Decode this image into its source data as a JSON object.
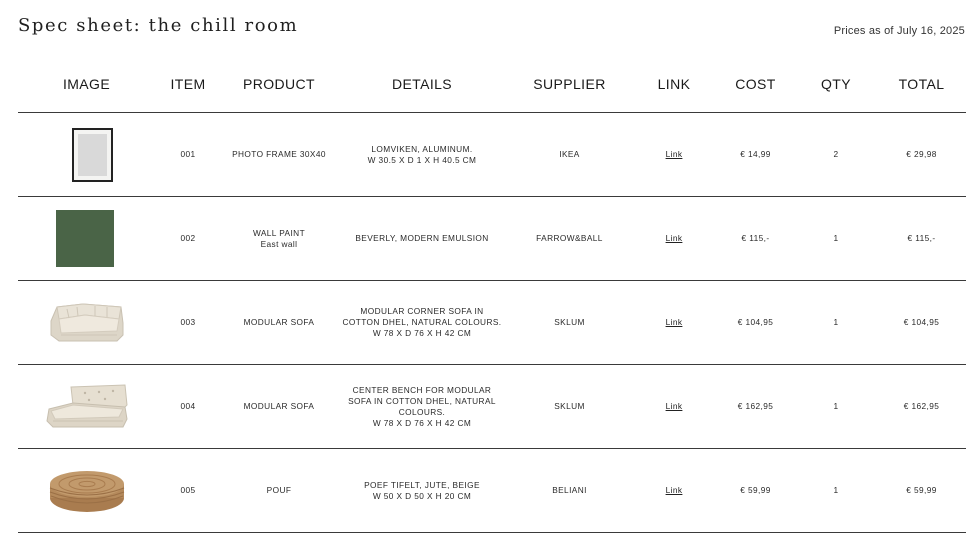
{
  "title": "Spec sheet: the chill room",
  "prices_as_of": "Prices as of July 16, 2025",
  "columns": {
    "image": "IMAGE",
    "item": "ITEM",
    "product": "PRODUCT",
    "details": "DETAILS",
    "supplier": "SUPPLIER",
    "link": "LINK",
    "cost": "COST",
    "qty": "QTY",
    "total": "TOTAL"
  },
  "rows": [
    {
      "image_icon": "photo-frame-image",
      "item": "001",
      "product": "PHOTO FRAME 30X40",
      "product_sub": "",
      "details_line1": "LOMVIKEN, ALUMINUM.",
      "details_line2": "W 30.5 X D 1 X H 40.5 CM",
      "details_line3": "",
      "supplier": "IKEA",
      "link": "Link",
      "cost": "€ 14,99",
      "qty": "2",
      "total": "€ 29,98"
    },
    {
      "image_icon": "paint-swatch-image",
      "item": "002",
      "product": "WALL PAINT",
      "product_sub": "East wall",
      "details_line1": "BEVERLY, MODERN EMULSION",
      "details_line2": "",
      "details_line3": "",
      "supplier": "FARROW&BALL",
      "link": "Link",
      "cost": "€ 115,-",
      "qty": "1",
      "total": "€ 115,-"
    },
    {
      "image_icon": "corner-sofa-image",
      "item": "003",
      "product": "MODULAR SOFA",
      "product_sub": "",
      "details_line1": "MODULAR CORNER SOFA IN",
      "details_line2": "COTTON DHEL, NATURAL COLOURS.",
      "details_line3": "W 78 X D 76 X H 42 CM",
      "supplier": "SKLUM",
      "link": "Link",
      "cost": "€ 104,95",
      "qty": "1",
      "total": "€ 104,95"
    },
    {
      "image_icon": "bench-sofa-image",
      "item": "004",
      "product": "MODULAR SOFA",
      "product_sub": "",
      "details_line1": "CENTER BENCH FOR MODULAR",
      "details_line2": "SOFA IN COTTON DHEL, NATURAL COLOURS.",
      "details_line3": "W 78 X D 76 X H 42 CM",
      "supplier": "SKLUM",
      "link": "Link",
      "cost": "€ 162,95",
      "qty": "1",
      "total": "€ 162,95"
    },
    {
      "image_icon": "jute-pouf-image",
      "item": "005",
      "product": "POUF",
      "product_sub": "",
      "details_line1": "POEF TIFELT, JUTE, BEIGE",
      "details_line2": "W 50 X D 50 X H 20 CM",
      "details_line3": "",
      "supplier": "BELIANI",
      "link": "Link",
      "cost": "€ 59,99",
      "qty": "1",
      "total": "€ 59,99"
    }
  ],
  "colors": {
    "paint_swatch": "#4a6447",
    "sofa": "#e6e0d4",
    "pouf": "#b58a5c",
    "rule": "#3a3a3a"
  }
}
